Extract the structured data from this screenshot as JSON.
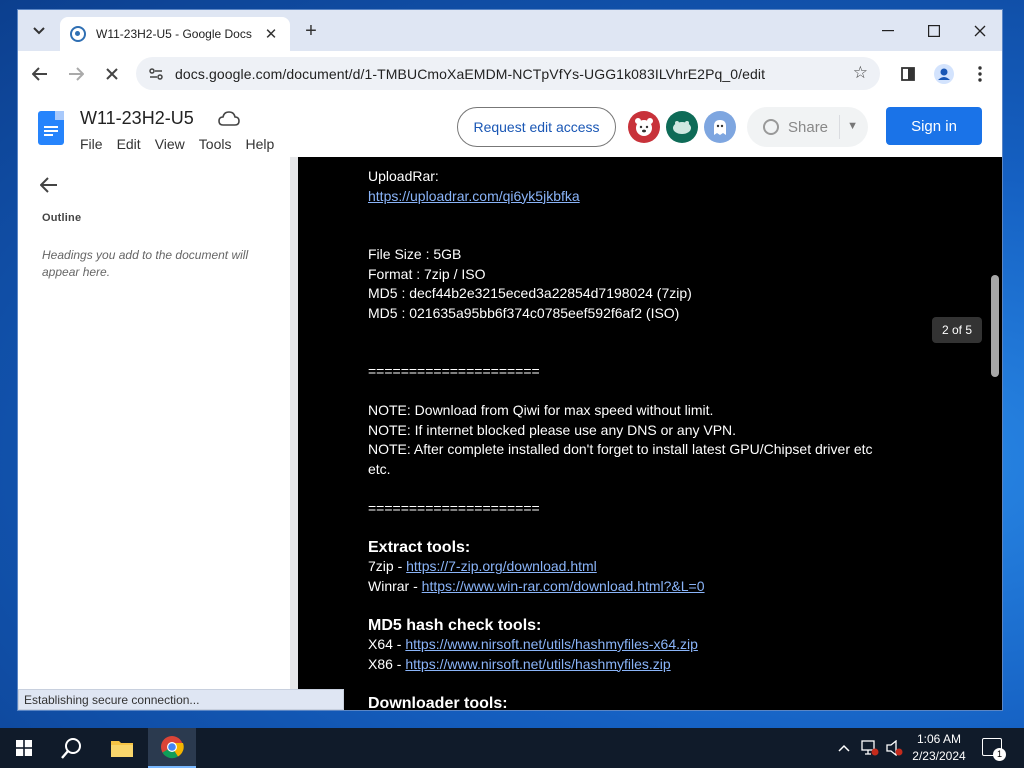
{
  "browser": {
    "tab_title": "W11-23H2-U5 - Google Docs",
    "url": "docs.google.com/document/d/1-TMBUCmoXaEMDM-NCTpVfYs-UGG1k083ILVhrE2Pq_0/edit",
    "status_text": "Establishing secure connection..."
  },
  "docs": {
    "title": "W11-23H2-U5",
    "menus": [
      "File",
      "Edit",
      "View",
      "Tools",
      "Help"
    ],
    "request_edit_label": "Request edit access",
    "share_label": "Share",
    "signin_label": "Sign in"
  },
  "sidebar": {
    "outline_label": "Outline",
    "hint": "Headings you add to the document will appear here."
  },
  "page_indicator": "2 of 5",
  "document": {
    "uploadrar_label": "UploadRar:",
    "uploadrar_link": "https://uploadrar.com/qi6yk5jkbfka",
    "file_size": "File Size : 5GB",
    "format": "Format : 7zip / ISO",
    "md5_zip": "MD5  : decf44b2e3215eced3a22854d7198024 (7zip)",
    "md5_iso": "MD5  : 021635a95bb6f374c0785eef592f6af2 (ISO)",
    "separator": "=====================",
    "note1": "NOTE: Download from Qiwi for max speed without limit.",
    "note2": "NOTE: If internet blocked please use any DNS or any VPN.",
    "note3_a": "NOTE: After complete installed don't forget to install latest GPU/Chipset driver etc",
    "note3_b": "etc.",
    "extract_heading": "Extract tools:",
    "zip_prefix": "7zip - ",
    "zip_link": "https://7-zip.org/download.html",
    "winrar_prefix": "Winrar - ",
    "winrar_link": "https://www.win-rar.com/download.html?&L=0",
    "md5_heading": "MD5 hash check tools:",
    "x64_prefix": "X64 - ",
    "x64_link": "https://www.nirsoft.net/utils/hashmyfiles-x64.zip",
    "x86_prefix": "X86 - ",
    "x86_link": "https://www.nirsoft.net/utils/hashmyfiles.zip",
    "downloader_heading": "Downloader tools:"
  },
  "taskbar": {
    "time": "1:06 AM",
    "date": "2/23/2024",
    "notification_count": "1"
  },
  "colors": {
    "link": "#8ab4f8",
    "signin": "#1a73e8",
    "request_text": "#1a57b5"
  },
  "icons": [
    "tab-search-icon",
    "docs-favicon-icon",
    "close-icon",
    "plus-icon",
    "minimize-icon",
    "maximize-icon",
    "back-icon",
    "forward-icon",
    "stop-icon",
    "site-info-icon",
    "star-icon",
    "side-panel-icon",
    "profile-icon",
    "menu-icon",
    "docs-logo-icon",
    "cloud-icon",
    "globe-icon",
    "chevron-down-icon",
    "arrow-left-icon",
    "windows-start-icon",
    "search-icon",
    "file-explorer-icon",
    "chrome-icon",
    "chevron-up-icon",
    "network-icon",
    "volume-icon",
    "notification-icon"
  ]
}
